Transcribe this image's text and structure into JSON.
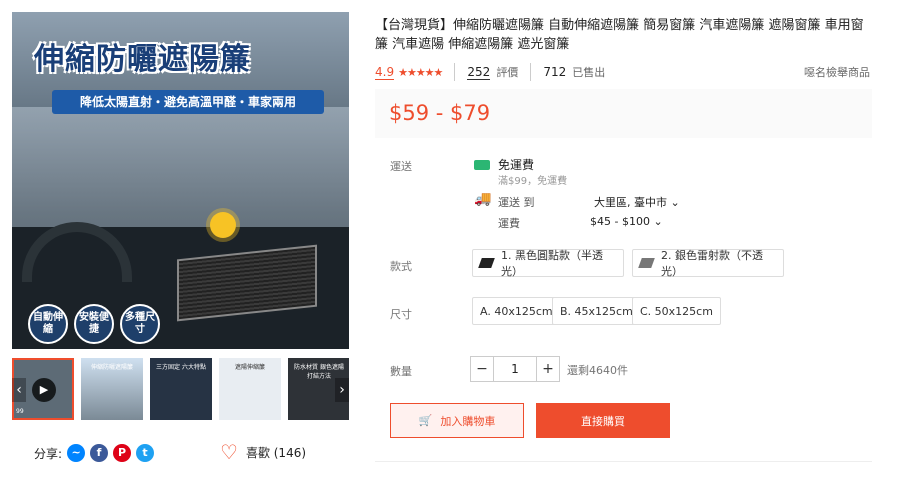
{
  "gallery": {
    "hero_title": "伸縮防曬遮陽簾",
    "hero_banner": "降低太陽直射・避免高溫甲醛・車家兩用",
    "features": [
      "自動伸縮",
      "安裝便捷",
      "多種尺寸"
    ],
    "thumb_price": "99",
    "thumb_captions": [
      "",
      "伸縮防曬遮陽簾",
      "三方固定 六大特點",
      "遮陽伸縮簾",
      "防水材質 銀色遮陽 打結方法"
    ]
  },
  "share": {
    "label": "分享:",
    "icons": [
      "messenger-icon",
      "facebook-icon",
      "pinterest-icon",
      "twitter-icon"
    ]
  },
  "like": {
    "label": "喜歡 (146)"
  },
  "product": {
    "title": "【台灣現貨】伸縮防曬遮陽簾 自動伸縮遮陽簾 簡易窗簾 汽車遮陽簾 遮陽窗簾 車用窗簾 汽車遮陽 伸縮遮陽簾 遮光窗簾",
    "rating": "4.9",
    "stars": "★★★★★",
    "reviews_count": "252",
    "reviews_label": "評價",
    "sold_count": "712",
    "sold_label": "已售出",
    "report": "噁名檢舉商品",
    "price": "$59 - $79"
  },
  "shipping": {
    "label": "運送",
    "free": "免運費",
    "free_sub": "滿$99，免運費",
    "shipto_label": "運送 到",
    "shipto_value": "大里區, 臺中市",
    "fee_label": "運費",
    "fee_value": "$45 - $100"
  },
  "variants": {
    "label": "款式",
    "options": [
      "1. 黑色圓點款（半透光）",
      "2. 銀色雷射款（不透光）"
    ]
  },
  "sizes": {
    "label": "尺寸",
    "options": [
      "A. 40x125cm",
      "B. 45x125cm",
      "C. 50x125cm"
    ]
  },
  "quantity": {
    "label": "數量",
    "minus": "−",
    "value": "1",
    "plus": "+",
    "stock": "還剩4640件"
  },
  "actions": {
    "add_to_cart": "加入購物車",
    "buy_now": "直接購買"
  },
  "colors": {
    "accent": "#ee4d2d",
    "accent_bg": "#fff1ef",
    "free_tag": "#2bb673",
    "messenger": "#0084ff",
    "facebook": "#3b5999",
    "pinterest": "#de0217",
    "twitter": "#1ea1f2"
  }
}
